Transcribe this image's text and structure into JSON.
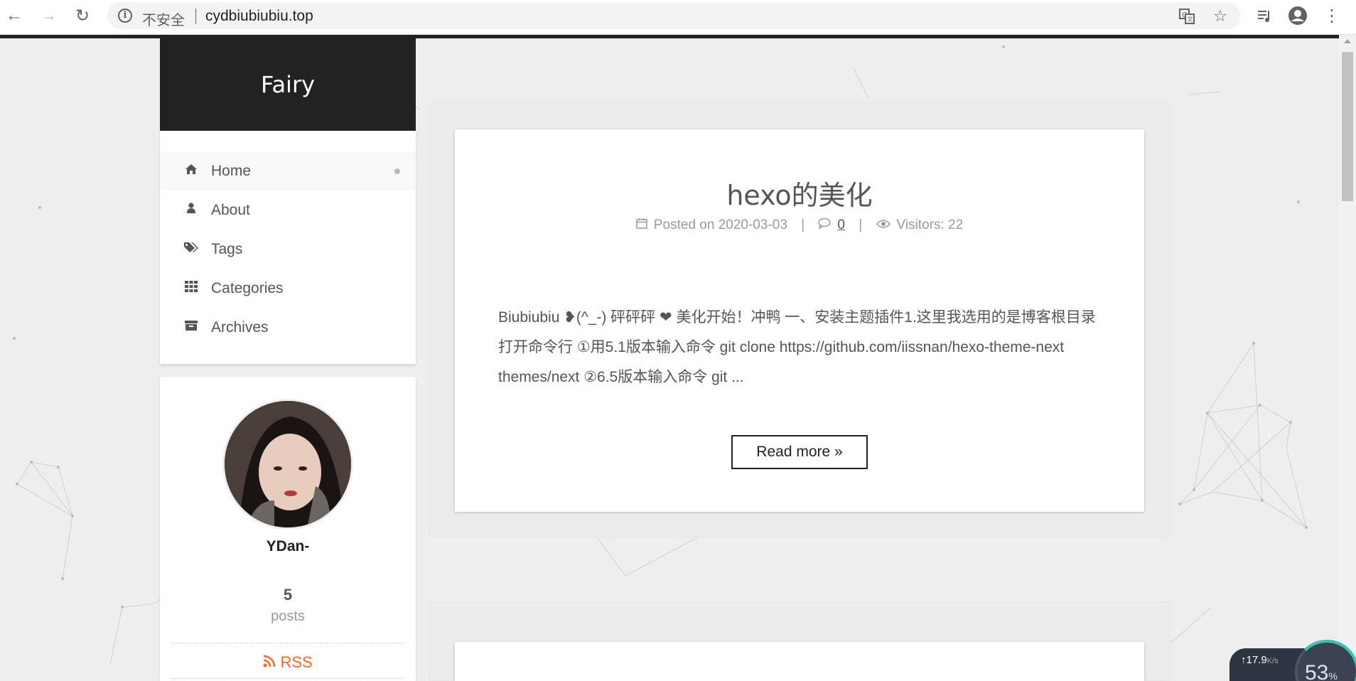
{
  "browser": {
    "security_label": "不安全",
    "url": "cydbiubiubiu.top",
    "icons": [
      "back-arrow-icon",
      "forward-arrow-icon",
      "reload-icon",
      "info-icon",
      "translate-icon",
      "star-icon",
      "media-queue-icon",
      "account-icon",
      "more-vert-icon"
    ]
  },
  "site": {
    "title": "Fairy"
  },
  "menu": {
    "items": [
      {
        "label": "Home",
        "icon": "home-icon",
        "active": true
      },
      {
        "label": "About",
        "icon": "user-icon",
        "active": false
      },
      {
        "label": "Tags",
        "icon": "tags-icon",
        "active": false
      },
      {
        "label": "Categories",
        "icon": "grid-icon",
        "active": false
      },
      {
        "label": "Archives",
        "icon": "archive-icon",
        "active": false
      }
    ]
  },
  "profile": {
    "author": "YDan-",
    "posts_count": "5",
    "posts_label": "posts",
    "rss_label": "RSS"
  },
  "post": {
    "title": "hexo的美化",
    "posted_label": "Posted on 2020-03-03",
    "comments_count": "0",
    "visitors_label": "Visitors: 22",
    "excerpt": "Biubiubiu ❥(^_-) 砰砰砰 ❤ 美化开始！冲鸭 一、安装主题插件1.这里我选用的是博客根目录打开命令行 ①用5.1版本输入命令 git clone https://github.com/iissnan/hexo-theme-next themes/next ②6.5版本输入命令 git ...",
    "read_more": "Read more »"
  },
  "widget": {
    "net_speed": "↑17.9",
    "net_unit": "K/s",
    "cpu_value": "53",
    "cpu_unit": "%"
  }
}
